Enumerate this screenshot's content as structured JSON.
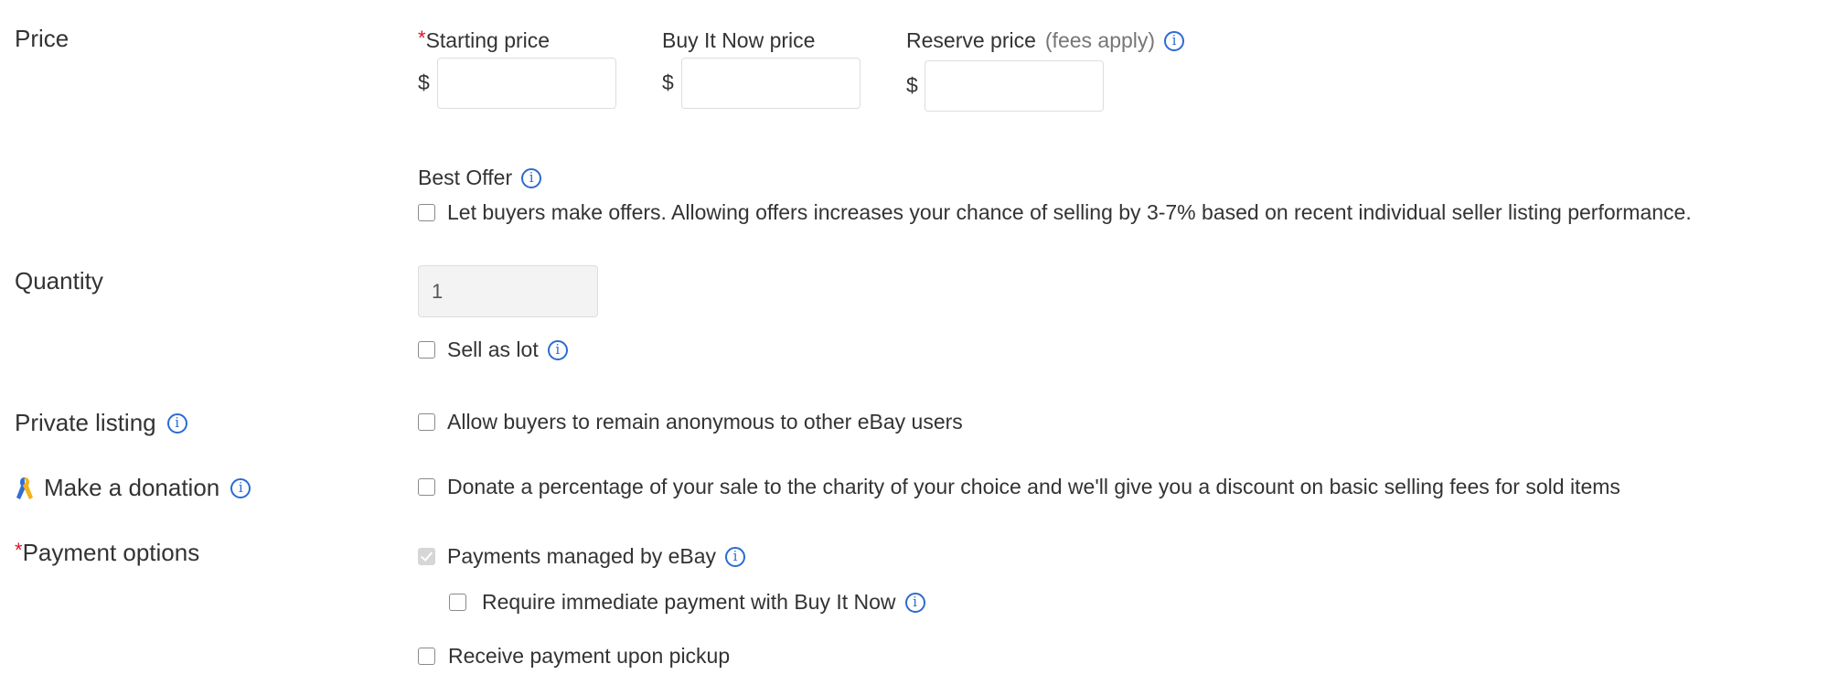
{
  "price": {
    "section_label": "Price",
    "starting_price": {
      "required_marker": "*",
      "label": "Starting price",
      "currency": "$",
      "value": "",
      "placeholder": ""
    },
    "buy_it_now_price": {
      "label": "Buy It Now price",
      "currency": "$",
      "value": "",
      "placeholder": ""
    },
    "reserve_price": {
      "label": "Reserve price",
      "note": "(fees apply)",
      "currency": "$",
      "value": "",
      "placeholder": "",
      "icon": "info-icon"
    },
    "best_offer": {
      "label": "Best Offer",
      "icon": "info-icon",
      "checkbox_label": "Let buyers make offers. Allowing offers increases your chance of selling by 3-7% based on recent individual seller listing performance.",
      "checked": false
    }
  },
  "quantity": {
    "section_label": "Quantity",
    "value": "1",
    "sell_as_lot": {
      "label": "Sell as lot",
      "checked": false,
      "icon": "info-icon"
    }
  },
  "private_listing": {
    "section_label": "Private listing",
    "icon": "info-icon",
    "checkbox_label": "Allow buyers to remain anonymous to other eBay users",
    "checked": false
  },
  "donation": {
    "section_label": "Make a donation",
    "leading_icon": "charity-ribbon-icon",
    "icon": "info-icon",
    "checkbox_label": "Donate a percentage of your sale to the charity of your choice and we'll give you a discount on basic selling fees for sold items",
    "checked": false
  },
  "payment_options": {
    "required_marker": "*",
    "section_label": "Payment options",
    "options": [
      {
        "label": "Payments managed by eBay",
        "checked": true,
        "disabled": true,
        "icon": "info-icon"
      },
      {
        "label": "Require immediate payment with Buy It Now",
        "checked": false,
        "icon": "info-icon",
        "indented": true
      },
      {
        "label": "Receive payment upon pickup",
        "checked": false
      }
    ]
  },
  "colors": {
    "link_blue": "#3665f3",
    "required_red": "#e0102c",
    "text": "#333333",
    "muted": "#767676"
  }
}
